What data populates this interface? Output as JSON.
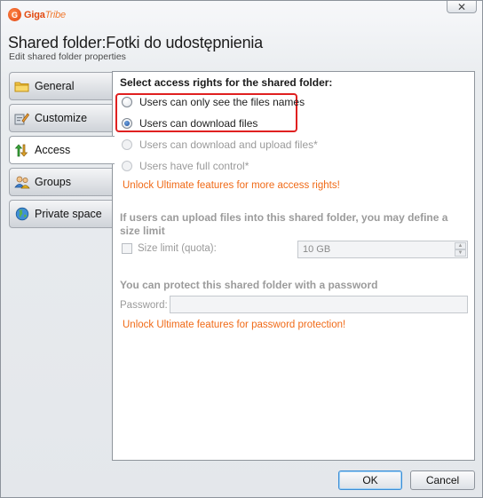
{
  "app": {
    "logo_mark": "G",
    "logo_name_a": "Giga",
    "logo_name_b": "Tribe",
    "close_glyph": "✕"
  },
  "header": {
    "title": "Shared folder:Fotki do udostępnienia",
    "subtitle": "Edit shared folder properties"
  },
  "nav": {
    "tabs": [
      {
        "label": "General",
        "icon": "folder-icon",
        "active": false
      },
      {
        "label": "Customize",
        "icon": "customize-icon",
        "active": false
      },
      {
        "label": "Access",
        "icon": "access-arrows-icon",
        "active": true
      },
      {
        "label": "Groups",
        "icon": "groups-icon",
        "active": false
      },
      {
        "label": "Private space",
        "icon": "globe-icon",
        "active": false
      }
    ]
  },
  "access": {
    "heading": "Select access rights for the shared folder:",
    "options": [
      {
        "label": "Users can only see the files names",
        "checked": false,
        "disabled": false
      },
      {
        "label": "Users can download files",
        "checked": true,
        "disabled": false
      },
      {
        "label": "Users can download and upload files*",
        "checked": false,
        "disabled": true
      },
      {
        "label": "Users have full control*",
        "checked": false,
        "disabled": true
      }
    ],
    "unlock_rights": "Unlock Ultimate features for more access rights!"
  },
  "quota": {
    "heading": "If users can upload files into this shared folder, you may define a size limit",
    "checkbox_label": "Size limit (quota):",
    "value": "10 GB"
  },
  "password": {
    "heading": "You can protect this shared folder with a password",
    "label": "Password:",
    "value": "",
    "unlock": "Unlock Ultimate features for password protection!"
  },
  "footer": {
    "ok": "OK",
    "cancel": "Cancel"
  },
  "colors": {
    "highlight": "#e02020",
    "unlock_text": "#f06a17",
    "brand": "#e24a10"
  }
}
